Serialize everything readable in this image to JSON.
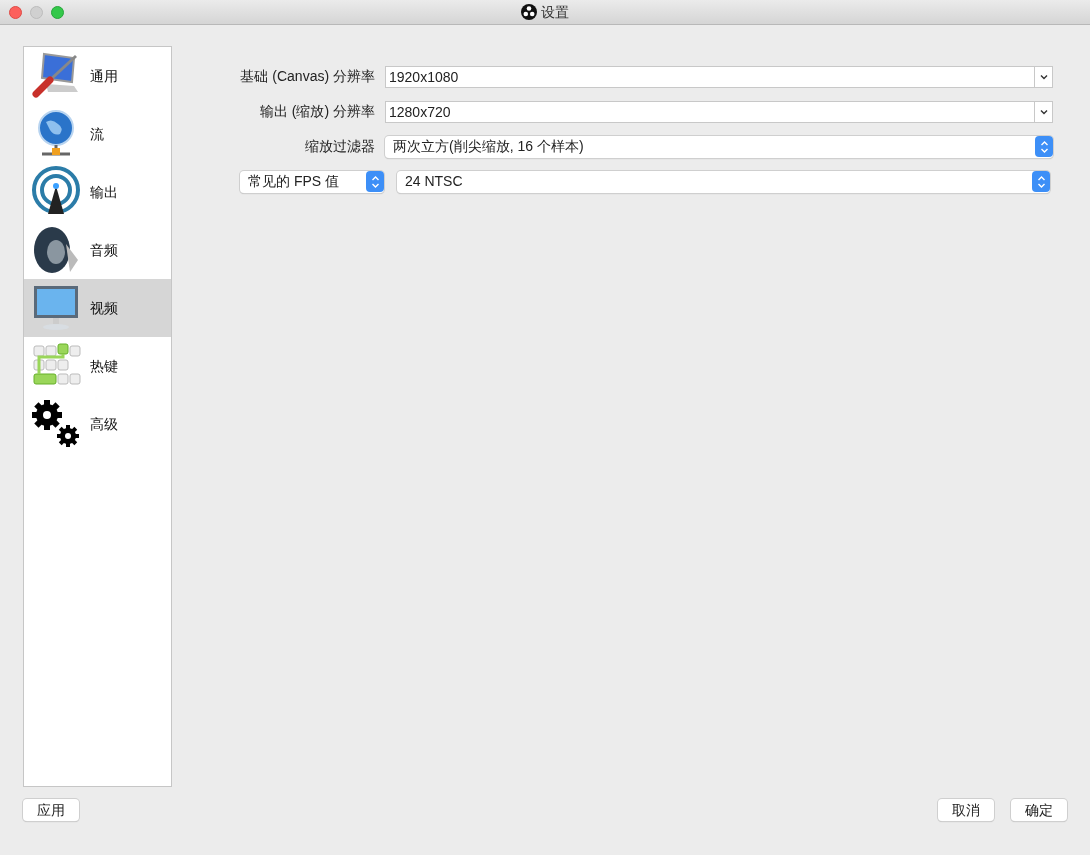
{
  "window": {
    "title": "设置"
  },
  "sidebar": {
    "items": [
      {
        "label": "通用",
        "kind": "general",
        "selected": false
      },
      {
        "label": "流",
        "kind": "stream",
        "selected": false
      },
      {
        "label": "输出",
        "kind": "output",
        "selected": false
      },
      {
        "label": "音频",
        "kind": "audio",
        "selected": false
      },
      {
        "label": "视频",
        "kind": "video",
        "selected": true
      },
      {
        "label": "热键",
        "kind": "hotkeys",
        "selected": false
      },
      {
        "label": "高级",
        "kind": "advanced",
        "selected": false
      }
    ]
  },
  "form": {
    "rows": [
      {
        "label": "基础 (Canvas) 分辨率",
        "kind": "combo",
        "value": "1920x1080"
      },
      {
        "label": "输出 (缩放) 分辨率",
        "kind": "combo",
        "value": "1280x720"
      },
      {
        "label": "缩放过滤器",
        "kind": "select",
        "value": "两次立方(削尖缩放, 16 个样本)"
      }
    ],
    "fps": {
      "type": "常见的 FPS 值",
      "value": "24 NTSC"
    }
  },
  "buttons": {
    "apply": "应用",
    "cancel": "取消",
    "ok": "确定"
  }
}
